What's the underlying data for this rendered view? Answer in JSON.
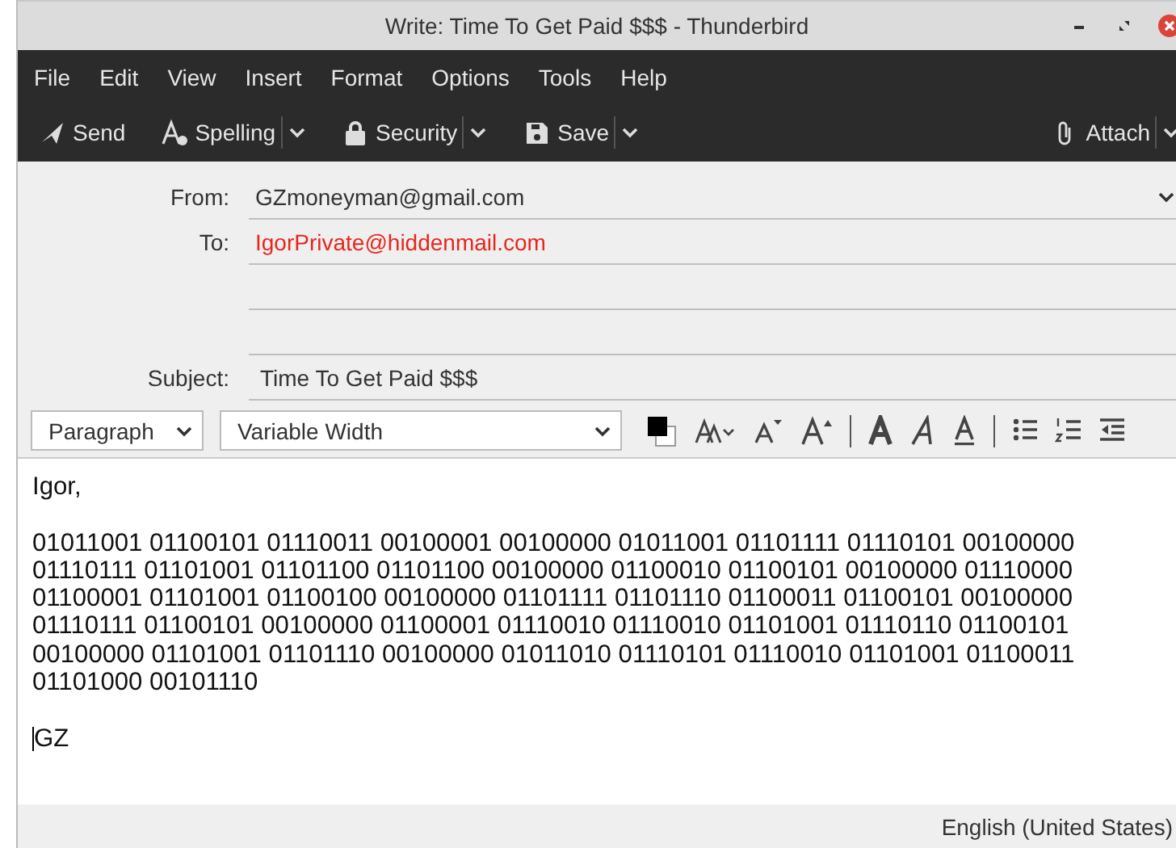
{
  "window": {
    "title": "Write: Time To Get Paid $$$ - Thunderbird"
  },
  "menu": [
    "File",
    "Edit",
    "View",
    "Insert",
    "Format",
    "Options",
    "Tools",
    "Help"
  ],
  "toolbar": [
    {
      "kind": "send",
      "label": "Send",
      "dropdown": false
    },
    {
      "kind": "spelling",
      "label": "Spelling",
      "dropdown": true
    },
    {
      "kind": "security",
      "label": "Security",
      "dropdown": true
    },
    {
      "kind": "save",
      "label": "Save",
      "dropdown": true
    },
    {
      "kind": "attach",
      "label": "Attach",
      "dropdown": true
    }
  ],
  "header": {
    "from_label": "From:",
    "from": "GZmoneyman@gmail.com",
    "to_label": "To:",
    "to": "IgorPrivate@hiddenmail.com",
    "subject_label": "Subject:",
    "subject": "Time To Get Paid $$$"
  },
  "format_bar": {
    "paragraph": "Paragraph",
    "font": "Variable Width"
  },
  "body": {
    "paragraphs": [
      [
        "Igor,"
      ],
      [
        "01011001 01100101 01110011 00100001 00100000 01011001 01101111 01110101 00100000",
        "01110111 01101001 01101100 01101100 00100000 01100010 01100101 00100000 01110000",
        "01100001 01101001 01100100 00100000 01101111 01101110 01100011 01100101 00100000",
        "01110111 01100101 00100000 01100001 01110010 01110010 01101001 01110110 01100101",
        "00100000 01101001 01101110 00100000 01011010 01110101 01110010 01101001 01100011",
        "01101000 00101110"
      ],
      [
        "GZ"
      ]
    ]
  },
  "status_bar": {
    "language": "English (United States)"
  }
}
